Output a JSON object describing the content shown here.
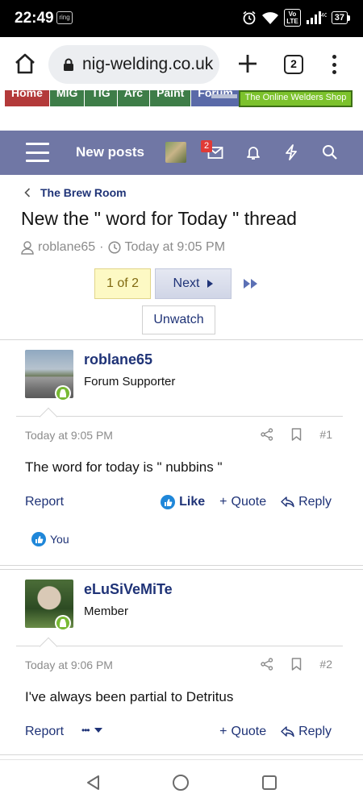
{
  "status_bar": {
    "time": "22:49",
    "ring_label": "ring",
    "volte_top": "Vo",
    "volte_bottom": "LTE",
    "network": "4G",
    "battery": "37"
  },
  "browser": {
    "url": "nig-welding.co.uk",
    "tab_count": "2"
  },
  "banner": {
    "nav": [
      {
        "label": "Home",
        "color": "#b33a3a"
      },
      {
        "label": "MIG",
        "color": "#3e7d48"
      },
      {
        "label": "TIG",
        "color": "#3e7d48"
      },
      {
        "label": "Arc",
        "color": "#3e7d48"
      },
      {
        "label": "Paint",
        "color": "#3e7d48"
      },
      {
        "label": "Forum",
        "color": "#5a6aa8"
      }
    ],
    "shop_label": "The Online Welders Shop"
  },
  "navbar": {
    "new_posts": "New posts",
    "inbox_badge": "2"
  },
  "thread": {
    "breadcrumb": "The Brew Room",
    "title": "New the \" word for Today \" thread",
    "author": "roblane65",
    "separator": "·",
    "date": "Today at 9:05 PM"
  },
  "pager": {
    "current": "1 of 2",
    "next": "Next"
  },
  "watch": {
    "label": "Unwatch"
  },
  "posts": [
    {
      "username": "roblane65",
      "user_title": "Forum Supporter",
      "date": "Today at 9:05 PM",
      "number": "#1",
      "body": "The word for today is \" nubbins \"",
      "report": "Report",
      "like": "Like",
      "quote": "Quote",
      "reply": "Reply",
      "reaction": "You"
    },
    {
      "username": "eLuSiVeMiTe",
      "user_title": "Member",
      "date": "Today at 9:06 PM",
      "number": "#2",
      "body": "I've always been partial to Detritus",
      "report": "Report",
      "more": "•••",
      "quote": "Quote",
      "reply": "Reply"
    }
  ],
  "colors": {
    "navbar": "#7077a5",
    "link": "#1f3377",
    "online": "#78b934",
    "like": "#1f87d9",
    "badge": "#e03a36"
  }
}
